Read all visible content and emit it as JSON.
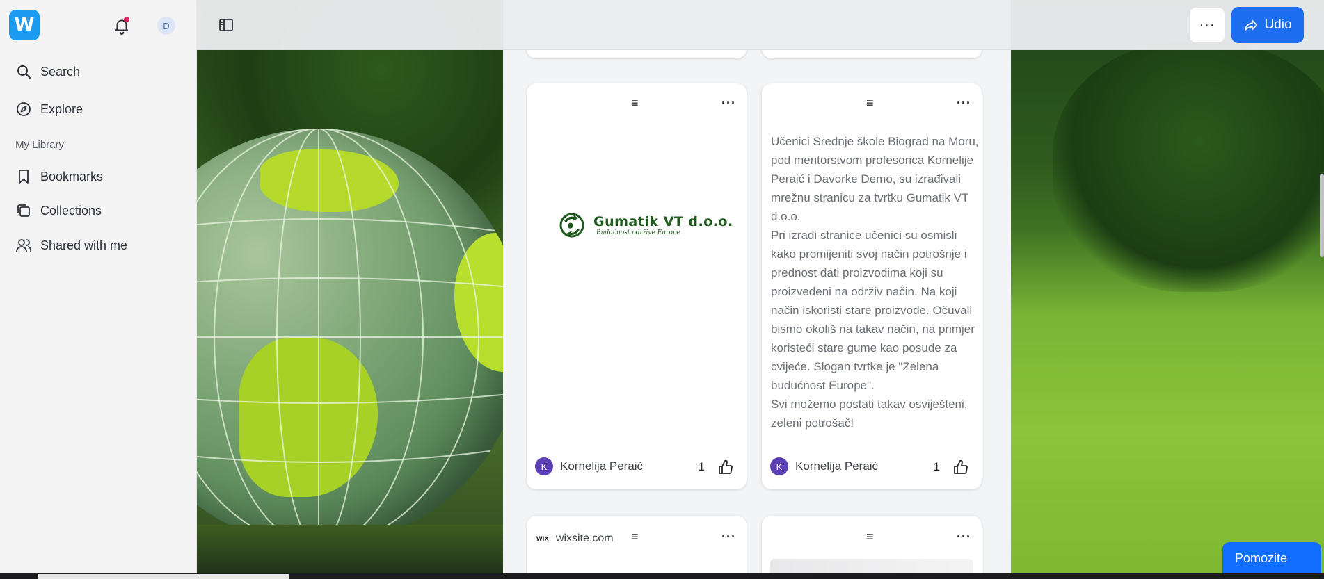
{
  "sidebar": {
    "logo_letter": "W",
    "user_initial": "D",
    "nav": {
      "search": "Search",
      "explore": "Explore",
      "section": "My Library",
      "bookmarks": "Bookmarks",
      "collections": "Collections",
      "shared": "Shared with me"
    }
  },
  "topbar": {
    "more_label": "···",
    "share_label": "Udio"
  },
  "cards": [
    {
      "brand_name": "Gumatik VT d.o.o.",
      "brand_tagline": "Budućnost održive Europe",
      "author": "Kornelija Peraić",
      "author_initial": "K",
      "likes": "1"
    },
    {
      "text": "Učenici Srednje škole Biograd na Moru, pod mentorstvom profesorica Kornelije Peraić i Davorke Demo,  su izrađivali mrežnu stranicu za tvrtku Gumatik VT d.o.o.\nPri izradi stranice učenici su osmisli kako promijeniti svoj način potrošnje i prednost dati proizvodima koji su proizvedeni na održiv način.  Na koji način iskoristi stare proizvode. Očuvali bismo okoliš na takav način, na primjer  koristeći stare gume kao posude za cvijeće. Slogan tvrtke je \"Zelena budućnost Europe\".\nSvi možemo postati takav osviješteni, zeleni potrošač!",
      "author": "Kornelija Peraić",
      "author_initial": "K",
      "likes": "1"
    },
    {
      "source_logo": "WIX",
      "source": "wixsite.com"
    },
    {}
  ],
  "help_button": "Pomozite",
  "colors": {
    "accent": "#1e6ef0",
    "logo": "#1d9bf0",
    "avatar": "#5b3fb5",
    "help": "#116dff"
  }
}
